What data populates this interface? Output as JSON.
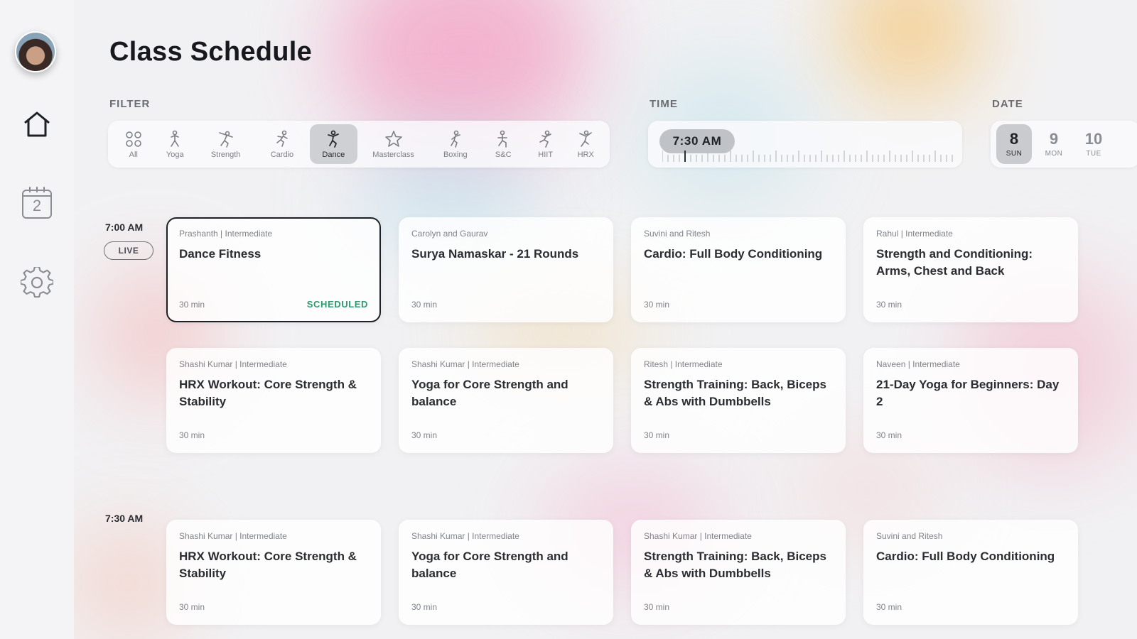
{
  "sidebar": {
    "calendar_day": "2"
  },
  "page": {
    "title": "Class Schedule"
  },
  "filter": {
    "label": "FILTER",
    "chips": [
      {
        "label": "All",
        "icon": "grid-icon"
      },
      {
        "label": "Yoga",
        "icon": "yoga-icon"
      },
      {
        "label": "Strength",
        "icon": "strength-icon"
      },
      {
        "label": "Cardio",
        "icon": "cardio-icon"
      },
      {
        "label": "Dance",
        "icon": "dance-icon",
        "active": true
      },
      {
        "label": "Masterclass",
        "icon": "star-icon"
      },
      {
        "label": "Boxing",
        "icon": "boxing-icon"
      },
      {
        "label": "S&C",
        "icon": "sc-icon"
      },
      {
        "label": "HIIT",
        "icon": "hiit-icon"
      },
      {
        "label": "HRX",
        "icon": "hrx-icon"
      }
    ]
  },
  "time": {
    "label": "TIME",
    "selected": "7:30 AM"
  },
  "date": {
    "label": "DATE",
    "days": [
      {
        "num": "8",
        "day": "SUN",
        "active": true
      },
      {
        "num": "9",
        "day": "MON"
      },
      {
        "num": "10",
        "day": "TUE"
      }
    ]
  },
  "slots": [
    {
      "time": "7:00 AM",
      "badge": "LIVE",
      "classes": [
        {
          "meta": "Prashanth | Intermediate",
          "title": "Dance Fitness",
          "duration": "30 min",
          "status": "SCHEDULED",
          "selected": true
        },
        {
          "meta": "Carolyn and Gaurav",
          "title": "Surya Namaskar - 21 Rounds",
          "duration": "30 min"
        },
        {
          "meta": "Suvini and Ritesh",
          "title": "Cardio: Full Body Conditioning",
          "duration": "30 min"
        },
        {
          "meta": "Rahul | Intermediate",
          "title": "Strength and Conditioning: Arms, Chest and Back",
          "duration": "30 min"
        },
        {
          "meta": "Shashi Kumar | Intermediate",
          "title": "HRX Workout: Core Strength & Stability",
          "duration": "30 min"
        },
        {
          "meta": "Shashi Kumar | Intermediate",
          "title": "Yoga for Core Strength and balance",
          "duration": "30 min"
        },
        {
          "meta": "Ritesh | Intermediate",
          "title": "Strength Training: Back, Biceps & Abs with Dumbbells",
          "duration": "30 min"
        },
        {
          "meta": "Naveen | Intermediate",
          "title": "21-Day Yoga for Beginners: Day 2",
          "duration": "30 min"
        }
      ]
    },
    {
      "time": "7:30 AM",
      "classes": [
        {
          "meta": "Shashi Kumar | Intermediate",
          "title": "HRX Workout: Core Strength & Stability",
          "duration": "30 min"
        },
        {
          "meta": "Shashi Kumar | Intermediate",
          "title": "Yoga for Core Strength and balance",
          "duration": "30 min"
        },
        {
          "meta": "Shashi Kumar | Intermediate",
          "title": "Strength Training: Back, Biceps & Abs with Dumbbells",
          "duration": "30 min"
        },
        {
          "meta": "Suvini and Ritesh",
          "title": "Cardio: Full Body Conditioning",
          "duration": "30 min"
        }
      ]
    }
  ]
}
